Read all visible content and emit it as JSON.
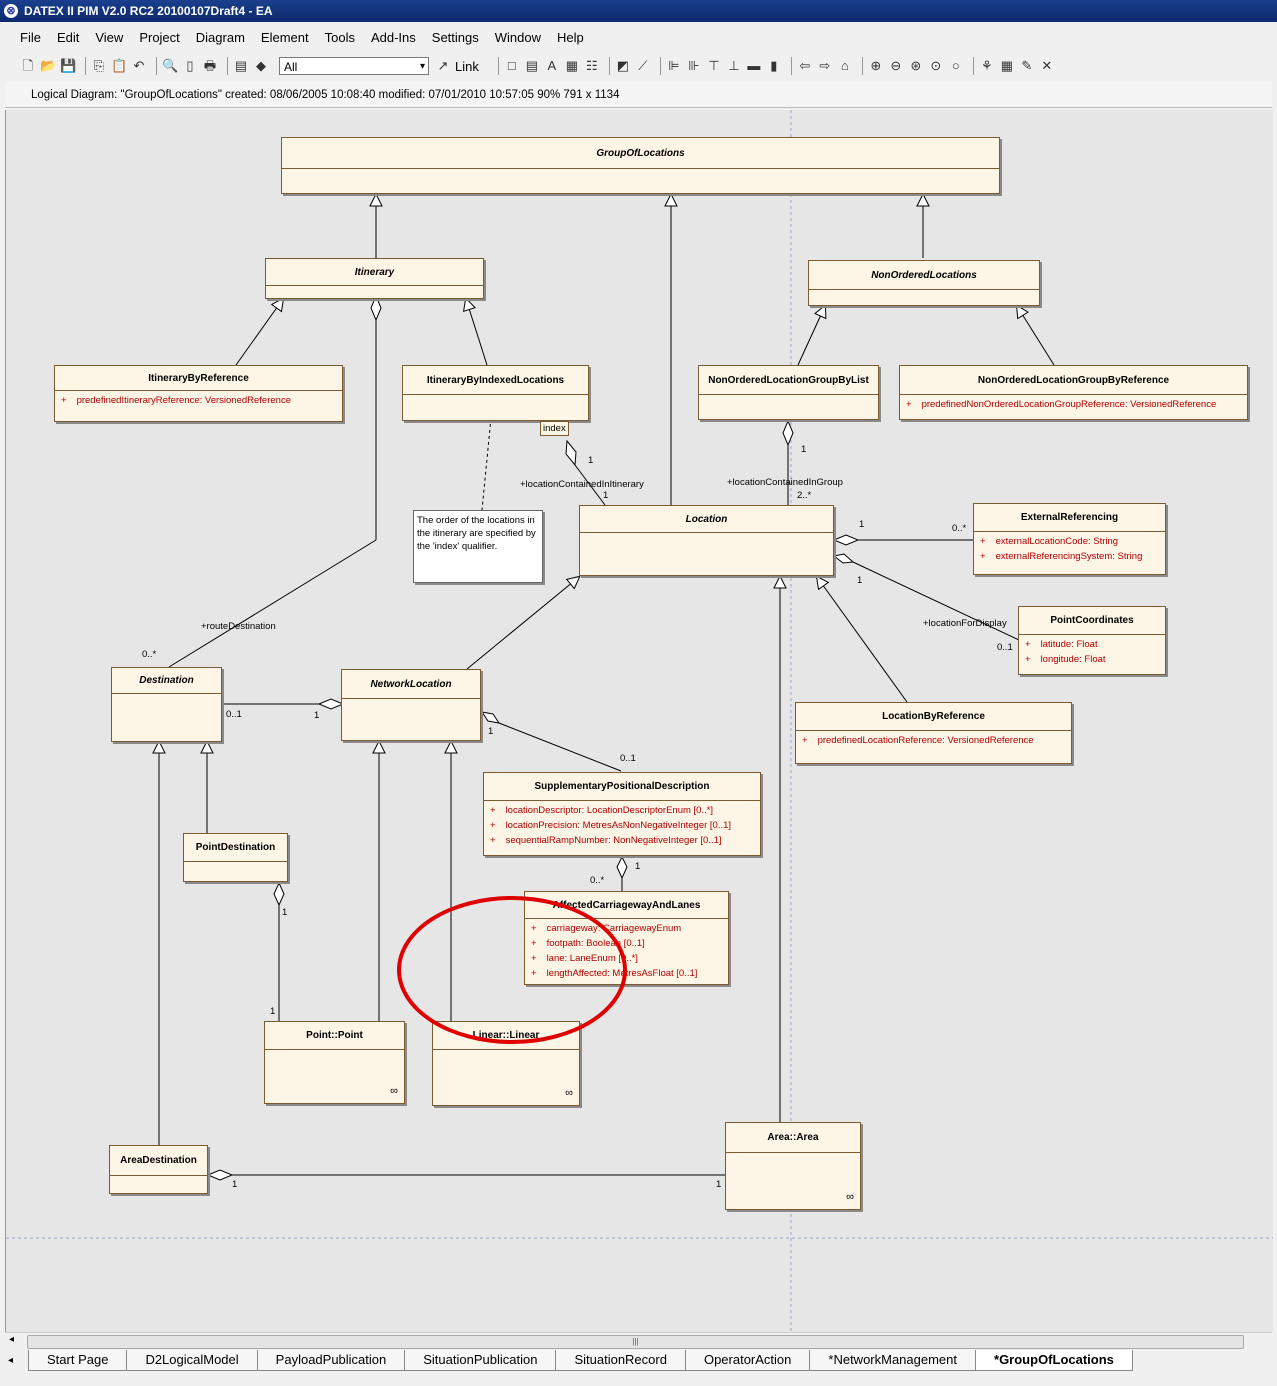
{
  "window": {
    "title": "DATEX II PIM V2.0 RC2 20100107Draft4 - EA"
  },
  "menu": [
    "File",
    "Edit",
    "View",
    "Project",
    "Diagram",
    "Element",
    "Tools",
    "Add-Ins",
    "Settings",
    "Window",
    "Help"
  ],
  "toolbar": {
    "filter_value": "All",
    "link_label": "Link"
  },
  "infobar": {
    "text": "Logical Diagram: \"GroupOfLocations\"  created: 08/06/2005 10:08:40  modified: 07/01/2010 10:57:05  90%  791 x 1134"
  },
  "diagram": {
    "classes": {
      "groupoflocations": {
        "name": "GroupOfLocations"
      },
      "itinerary": {
        "name": "Itinerary"
      },
      "nonorderedlocations": {
        "name": "NonOrderedLocations"
      },
      "itinerarybyreference": {
        "name": "ItineraryByReference",
        "attrs": [
          {
            "vis": "+",
            "text": "predefinedItineraryReference:  VersionedReference"
          }
        ]
      },
      "itinerarybyindexedlocations": {
        "name": "ItineraryByIndexedLocations"
      },
      "nonorderedbylist": {
        "name": "NonOrderedLocationGroupByList"
      },
      "nonorderedbyref": {
        "name": "NonOrderedLocationGroupByReference",
        "attrs": [
          {
            "vis": "+",
            "text": "predefinedNonOrderedLocationGroupReference:  VersionedReference"
          }
        ]
      },
      "location": {
        "name": "Location"
      },
      "externalreferencing": {
        "name": "ExternalReferencing",
        "attrs": [
          {
            "vis": "+",
            "text": "externalLocationCode:  String"
          },
          {
            "vis": "+",
            "text": "externalReferencingSystem:  String"
          }
        ]
      },
      "pointcoordinates": {
        "name": "PointCoordinates",
        "attrs": [
          {
            "vis": "+",
            "text": "latitude:  Float"
          },
          {
            "vis": "+",
            "text": "longitude:  Float"
          }
        ]
      },
      "locationbyreference": {
        "name": "LocationByReference",
        "attrs": [
          {
            "vis": "+",
            "text": "predefinedLocationReference:  VersionedReference"
          }
        ]
      },
      "destination": {
        "name": "Destination"
      },
      "networklocation": {
        "name": "NetworkLocation"
      },
      "supplementary": {
        "name": "SupplementaryPositionalDescription",
        "attrs": [
          {
            "vis": "+",
            "text": "locationDescriptor:  LocationDescriptorEnum [0..*]"
          },
          {
            "vis": "+",
            "text": "locationPrecision:  MetresAsNonNegativeInteger [0..1]"
          },
          {
            "vis": "+",
            "text": "sequentialRampNumber:  NonNegativeInteger [0..1]"
          }
        ]
      },
      "pointdestination": {
        "name": "PointDestination"
      },
      "affected": {
        "name": "AffectedCarriagewayAndLanes",
        "attrs": [
          {
            "vis": "+",
            "text": "carriageway:  CarriagewayEnum"
          },
          {
            "vis": "+",
            "text": "footpath:  Boolean [0..1]"
          },
          {
            "vis": "+",
            "text": "lane:  LaneEnum [0..*]"
          },
          {
            "vis": "+",
            "text": "lengthAffected:  MetresAsFloat [0..1]"
          }
        ]
      },
      "point": {
        "name": "Point::Point"
      },
      "linear": {
        "name": "Linear::Linear"
      },
      "area": {
        "name": "Area::Area"
      },
      "areadestination": {
        "name": "AreaDestination"
      }
    },
    "note": "The order of the locations in the itinerary are specified by the 'index' qualifier.",
    "qualifier": "index",
    "labels": {
      "loc_in_itinerary": "+locationContainedInItinerary",
      "loc_in_group": "+locationContainedInGroup",
      "route_dest": "+routeDestination",
      "loc_for_display": "+locationForDisplay",
      "m1": "1",
      "m2": "1",
      "m3": "1",
      "m4": "2..*",
      "m5": "1",
      "m6": "0..*",
      "m7": "1",
      "m8": "0..1",
      "m9": "0..*",
      "m10": "0..1",
      "m11": "1",
      "m12": "1",
      "m13": "0..1",
      "m14": "1",
      "m15": "0..*",
      "m16": "1",
      "m17": "1",
      "m18": "1",
      "m19": "1"
    }
  },
  "tabs": [
    "Start Page",
    "D2LogicalModel",
    "PayloadPublication",
    "SituationPublication",
    "SituationRecord",
    "OperatorAction",
    "*NetworkManagement",
    "*GroupOfLocations"
  ],
  "active_tab": "*GroupOfLocations"
}
